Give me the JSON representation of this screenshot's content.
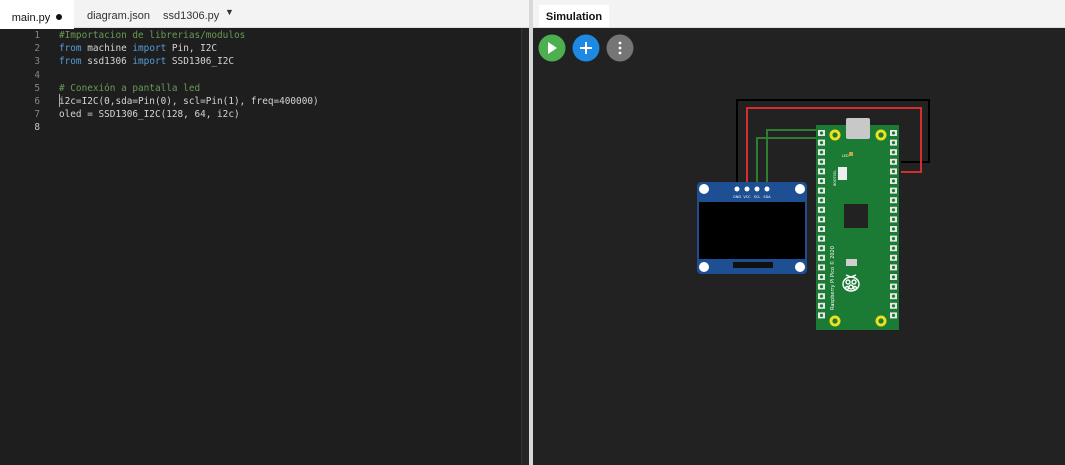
{
  "editor": {
    "tabs": [
      {
        "label": "main.py",
        "active": true,
        "modified": true
      },
      {
        "label": "diagram.json",
        "active": false
      },
      {
        "label": "ssd1306.py",
        "active": false
      }
    ],
    "more_tabs_icon": "caret-down-icon",
    "current_line": 8,
    "lines": [
      {
        "n": "1",
        "parts": [
          {
            "t": "#Importacion de librerias/modulos",
            "c": "cm"
          }
        ]
      },
      {
        "n": "2",
        "parts": [
          {
            "t": "from",
            "c": "kw"
          },
          {
            "t": " machine ",
            "c": ""
          },
          {
            "t": "import",
            "c": "kw"
          },
          {
            "t": " Pin, I2C",
            "c": ""
          }
        ]
      },
      {
        "n": "3",
        "parts": [
          {
            "t": "from",
            "c": "kw"
          },
          {
            "t": " ssd1306 ",
            "c": ""
          },
          {
            "t": "import",
            "c": "kw"
          },
          {
            "t": " SSD1306_I2C",
            "c": ""
          }
        ]
      },
      {
        "n": "4",
        "parts": []
      },
      {
        "n": "5",
        "parts": [
          {
            "t": "# Conexión a pantalla led",
            "c": "cm"
          }
        ]
      },
      {
        "n": "6",
        "parts": [
          {
            "t": "i2c=I2C(0,sda=Pin(0), scl=Pin(1), freq=400000)",
            "c": ""
          }
        ]
      },
      {
        "n": "7",
        "parts": [
          {
            "t": "oled = SSD1306_I2C(128, 64, i2c)",
            "c": ""
          }
        ]
      },
      {
        "n": "8",
        "parts": []
      }
    ]
  },
  "simulation": {
    "tab_label": "Simulation",
    "buttons": [
      {
        "name": "play-button",
        "icon": "play-icon",
        "color": "#4caf50"
      },
      {
        "name": "add-part-button",
        "icon": "plus-icon",
        "color": "#1e88e5"
      },
      {
        "name": "more-options-button",
        "icon": "kebab-menu-icon",
        "color": "#757575"
      }
    ],
    "oled": {
      "pin_labels": [
        "GND",
        "VCC",
        "SCL",
        "SDA"
      ]
    },
    "pico": {
      "board_label": "Raspberry Pi Pico © 2020",
      "led_label": "LED",
      "bootsel_label": "BOOTSEL"
    },
    "wires": [
      {
        "name": "gnd-wire",
        "color": "#000000"
      },
      {
        "name": "vcc-wire",
        "color": "#d32f2f"
      },
      {
        "name": "scl-wire",
        "color": "#2e7d32"
      },
      {
        "name": "sda-wire",
        "color": "#2e7d32"
      }
    ]
  }
}
